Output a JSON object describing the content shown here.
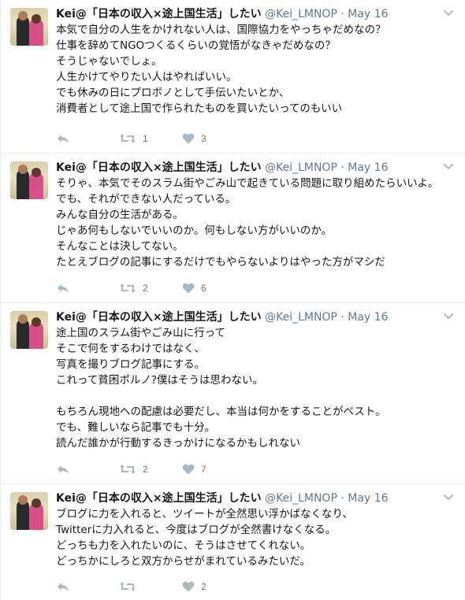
{
  "colors": {
    "icon": "#aab8c2",
    "text": "#14171a",
    "secondary": "#657786",
    "divider": "#e6ecf0"
  },
  "tweets": [
    {
      "name": "Kei@「日本の収入×途上国生活」したい",
      "handle": "@Kei_LMNOP",
      "dot": "·",
      "date": "May 16",
      "text": "本気で自分の人生をかけれない人は、国際協力をやっちゃだめなの？\n仕事を辞めてNGOつくるくらいの覚悟がなきゃだめなの？\nそうじゃないでしょ。\n人生かけてやりたい人はやればいい。\nでも休みの日にプロボノとして手伝いたいとか、\n消費者として途上国で作られたものを買いたいってのもいい",
      "retweets": "1",
      "likes": "3"
    },
    {
      "name": "Kei@「日本の収入×途上国生活」したい",
      "handle": "@Kei_LMNOP",
      "dot": "·",
      "date": "May 16",
      "text": "そりゃ、本気でそのスラム街やごみ山で起きている問題に取り組めたらいいよ。\nでも、それができない人だっている。\nみんな自分の生活がある。\nじゃあ何もしないでいいのか。何もしない方がいいのか。\nそんなことは決してない。\nたとえブログの記事にするだけでもやらないよりはやった方がマシだ",
      "retweets": "2",
      "likes": "6"
    },
    {
      "name": "Kei@「日本の収入×途上国生活」したい",
      "handle": "@Kei_LMNOP",
      "dot": "·",
      "date": "May 16",
      "text": "途上国のスラム街やごみ山に行って\nそこで何をするわけではなく、\n写真を撮りブログ記事にする。\nこれって貧困ポルノ?僕はそうは思わない。\n\nもちろん現地への配慮は必要だし、本当は何かをすることがベスト。\nでも、難しいなら記事でも十分。\n読んだ誰かが行動するきっかけになるかもしれない",
      "retweets": "2",
      "likes": "7"
    },
    {
      "name": "Kei@「日本の収入×途上国生活」したい",
      "handle": "@Kei_LMNOP",
      "dot": "·",
      "date": "May 16",
      "text": "ブログに力を入れると、ツイートが全然思い浮かばなくなり、\nTwitterに力入れると、今度はブログが全然書けなくなる。\nどっちも力を入れたいのに、そうはさせてくれない。\nどっちかにしろと双方からせがまれているみたいだ。",
      "retweets": "",
      "likes": "2"
    }
  ]
}
